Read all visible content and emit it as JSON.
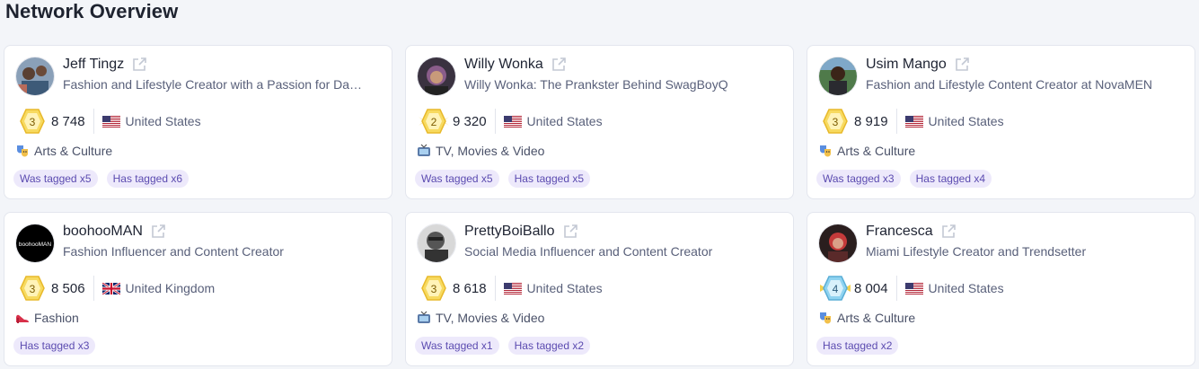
{
  "page": {
    "title": "Network Overview"
  },
  "profiles": [
    {
      "name": "Jeff Tingz",
      "description": "Fashion and Lifestyle Creator with a Passion for Da…",
      "level": "3",
      "score": "8 748",
      "country": "United States",
      "category": "Arts & Culture",
      "category_icon": "theater-masks-icon",
      "tags": [
        "Was tagged x5",
        "Has tagged x6"
      ]
    },
    {
      "name": "Willy Wonka",
      "description": "Willy Wonka: The Prankster Behind SwagBoyQ",
      "level": "2",
      "score": "9 320",
      "country": "United States",
      "category": "TV, Movies & Video",
      "category_icon": "tv-icon",
      "tags": [
        "Was tagged x5",
        "Has tagged x5"
      ]
    },
    {
      "name": "Usim Mango",
      "description": "Fashion and Lifestyle Content Creator at NovaMEN",
      "level": "3",
      "score": "8 919",
      "country": "United States",
      "category": "Arts & Culture",
      "category_icon": "theater-masks-icon",
      "tags": [
        "Was tagged x3",
        "Has tagged x4"
      ]
    },
    {
      "name": "boohooMAN",
      "description": "Fashion Influencer and Content Creator",
      "level": "3",
      "score": "8 506",
      "country": "United Kingdom",
      "category": "Fashion",
      "category_icon": "high-heel-icon",
      "tags": [
        "Has tagged x3"
      ],
      "avatar_text": "boohooMAN"
    },
    {
      "name": "PrettyBoiBallo",
      "description": "Social Media Influencer and Content Creator",
      "level": "3",
      "score": "8 618",
      "country": "United States",
      "category": "TV, Movies & Video",
      "category_icon": "tv-icon",
      "tags": [
        "Was tagged x1",
        "Has tagged x2"
      ]
    },
    {
      "name": "Francesca",
      "description": "Miami Lifestyle Creator and Trendsetter",
      "level": "4",
      "score": "8 004",
      "country": "United States",
      "category": "Arts & Culture",
      "category_icon": "theater-masks-icon",
      "tags": [
        "Has tagged x2"
      ]
    }
  ],
  "colors": {
    "background": "#f3f5f9",
    "card": "#ffffff",
    "tag_bg": "#ede9fb",
    "tag_text": "#5b4bb0",
    "badge_gold": "#f5d04a",
    "badge_diamond": "#8fd3f0"
  }
}
